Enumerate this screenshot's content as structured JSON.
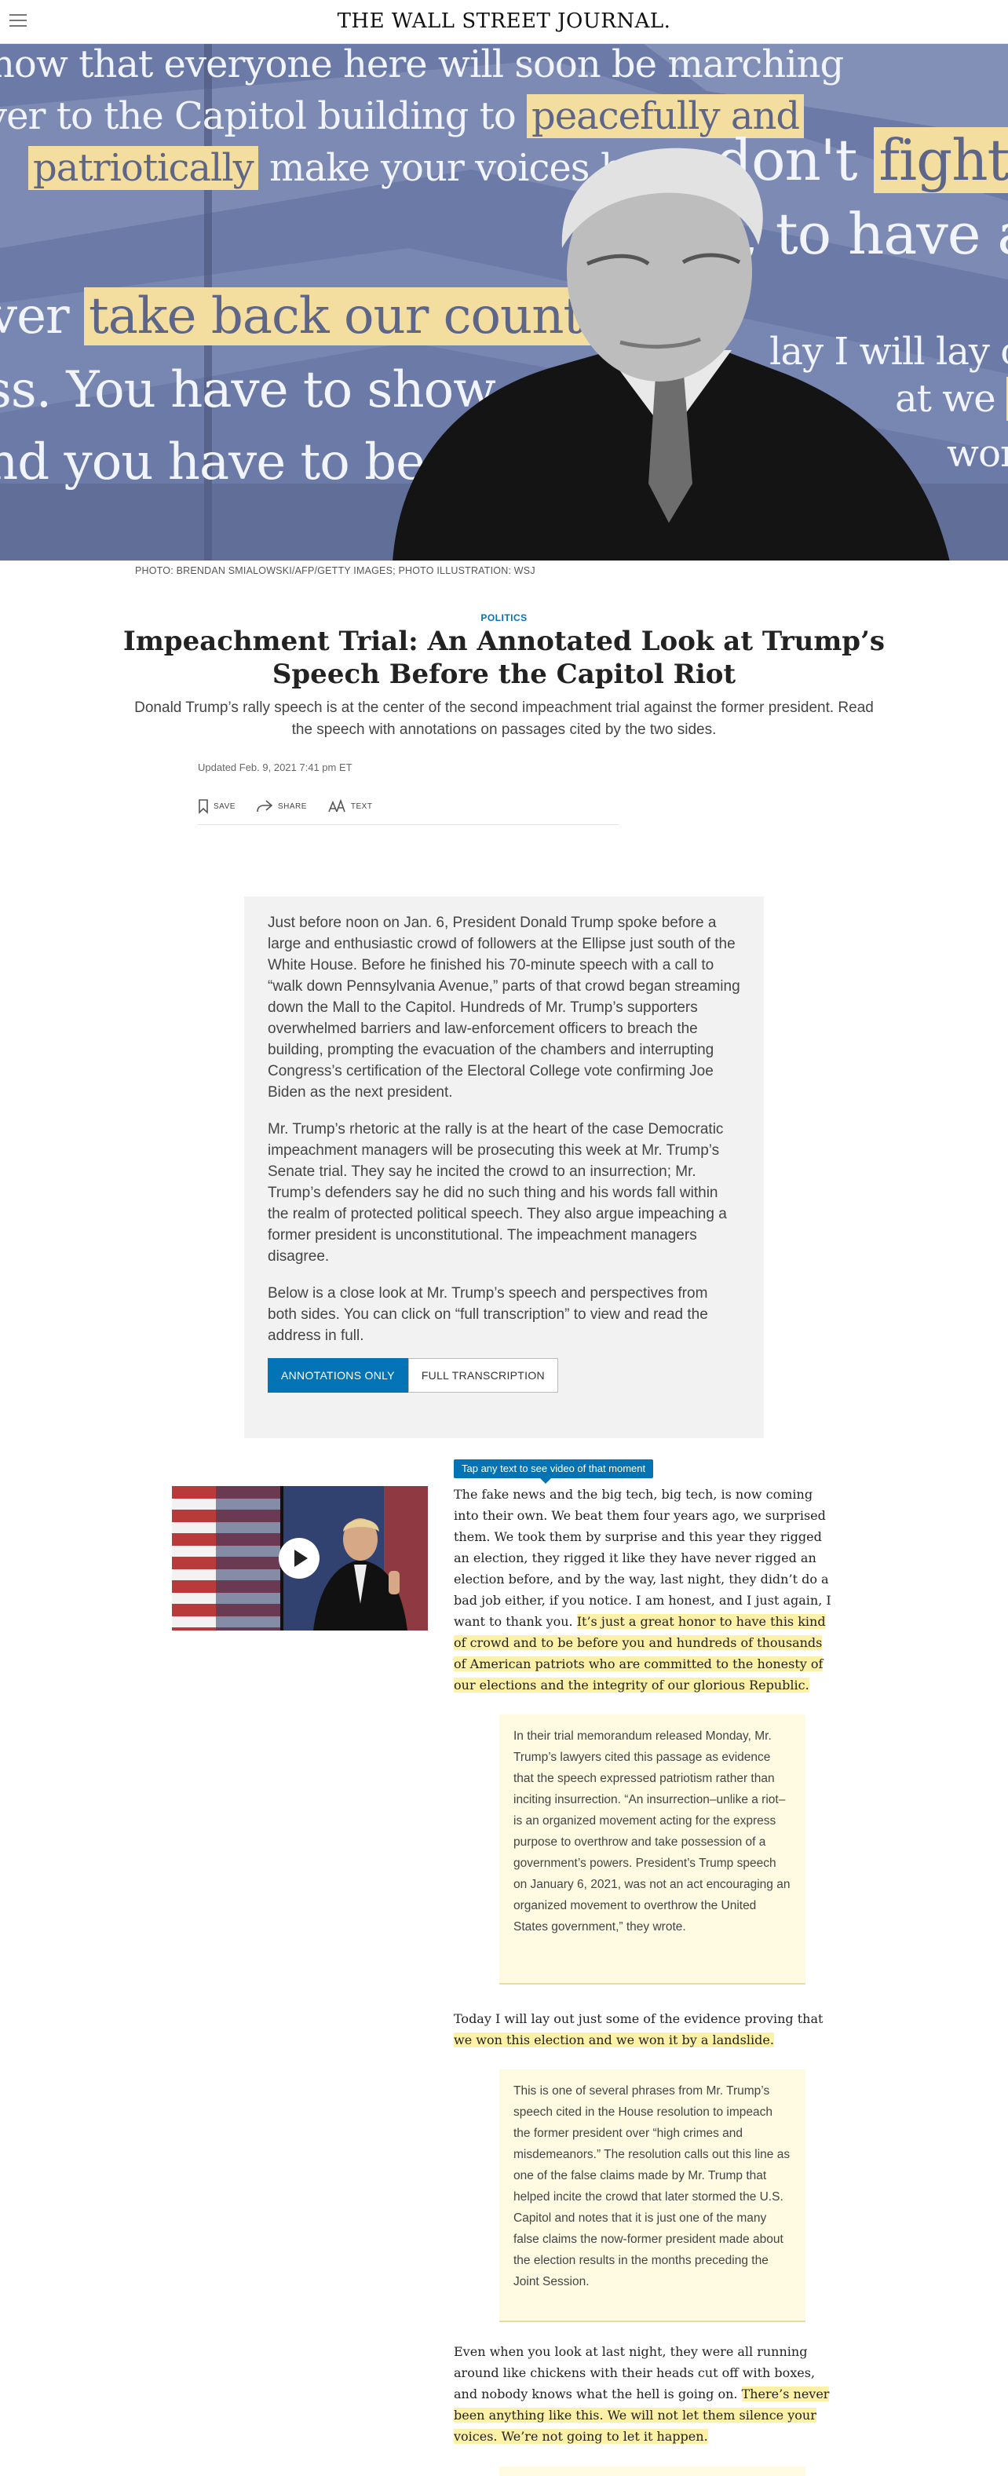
{
  "header": {
    "masthead": "THE WALL STREET JOURNAL.",
    "menu_icon": "hamburger-menu-icon"
  },
  "hero": {
    "lines": [
      {
        "before": "now that everyone here will soon be marching",
        "mark": "",
        "after": ""
      },
      {
        "before": "ver to the Capitol building to ",
        "mark": "peacefully and",
        "after": ""
      },
      {
        "before": "",
        "mark": "patriotically",
        "after": " make your voices he"
      },
      {
        "before": "don't ",
        "mark": "fight l",
        "after": ""
      },
      {
        "before": ", to have a c",
        "mark": "",
        "after": ""
      },
      {
        "before": "ver ",
        "mark": "take back our country",
        "after": " w"
      },
      {
        "before": "lay I will lay out",
        "mark": "",
        "after": ""
      },
      {
        "before": "ss. You have to show st",
        "mark": "",
        "after": ""
      },
      {
        "before": "at we ",
        "mark": "v",
        "after": ""
      },
      {
        "before": "nd you have to be str",
        "mark": "",
        "after": ""
      },
      {
        "before": "won",
        "mark": "",
        "after": ""
      }
    ],
    "photo_credit": "PHOTO: BRENDAN SMIALOWSKI/AFP/GETTY IMAGES; PHOTO ILLUSTRATION: WSJ"
  },
  "article": {
    "section": "POLITICS",
    "headline": "Impeachment Trial: An Annotated Look at Trump’s Speech Before the Capitol Riot",
    "dek": "Donald Trump’s rally speech is at the center of the second impeachment trial against the former president. Read the speech with annotations on passages cited by the two sides.",
    "updated": "Updated Feb. 9, 2021 7:41 pm ET",
    "tools": {
      "save": "SAVE",
      "share": "SHARE",
      "text": "TEXT"
    }
  },
  "intro": {
    "paragraphs": [
      "Just before noon on Jan. 6, President Donald Trump spoke before a large and enthusiastic crowd of followers at the Ellipse just south of the White House. Before he finished his 70-minute speech with a call to “walk down Pennsylvania Avenue,” parts of that crowd began streaming down the Mall to the Capitol. Hundreds of Mr. Trump’s supporters overwhelmed barriers and law-enforcement officers to breach the building, prompting the evacuation of the chambers and interrupting Congress’s certification of the Electoral College vote confirming Joe Biden as the next president.",
      "Mr. Trump’s rhetoric at the rally is at the heart of the case Democratic impeachment managers will be prosecuting this week at Mr. Trump’s Senate trial. They say he incited the crowd to an insurrection; Mr. Trump’s defenders say he did no such thing and his words fall within the realm of protected political speech. They also argue impeaching a former president is unconstitutional. The impeachment managers disagree.",
      "Below is a close look at Mr. Trump’s speech and perspectives from both sides. You can click on “full transcription” to view and read the address in full."
    ],
    "toggle": {
      "annotations": "ANNOTATIONS ONLY",
      "full": "FULL TRANSCRIPTION"
    }
  },
  "transcript": {
    "tip": "Tap any text to see video of that moment",
    "p1_plain": "The fake news and the big tech, big tech, is now coming into their own. We beat them four years ago, we surprised them. We took them by surprise and this year they rigged an election, they rigged it like they have never rigged an election before, and by the way, last night, they didn’t do a bad job either, if you notice. I am honest, and I just again, I want to thank you. ",
    "p1_mark": "It’s just a great honor to have this kind of crowd and to be before you and hundreds of thousands of American patriots who are committed to the honesty of our elections and the integrity of our glorious Republic.",
    "note1": "In their trial memorandum released Monday, Mr. Trump’s lawyers cited this passage as evidence that the speech expressed patriotism rather than inciting insurrection. “An insurrection–unlike a riot–is an organized movement acting for the express purpose to overthrow and take possession of a government’s powers. President’s Trump speech on January 6, 2021, was not an act encouraging an organized movement to overthrow the United States government,” they wrote.",
    "p2_plain": "Today I will lay out just some of the evidence proving that ",
    "p2_mark": "we won this election and we won it by a landslide.",
    "note2": "This is one of several phrases from Mr. Trump’s speech cited in the House resolution to impeach the former president over “high crimes and misdemeanors.” The resolution calls out this line as one of the false claims made by Mr. Trump that helped incite the crowd that later stormed the U.S. Capitol and notes that it is just one of the many false claims the now-former president made about the election results in the months preceding the Joint Session.",
    "p3_plain": "Even when you look at last night, they were all running around like chickens with their heads cut off with boxes, and nobody knows what the hell is going on. ",
    "p3_mark": "There’s never been anything like this. We will not let them silence your voices. We’re not going to let it happen."
  },
  "colors": {
    "accent": "#0274b6",
    "highlight": "#fdf1a8",
    "hero_highlight": "#f3dea0",
    "note_bg": "#fefbe2"
  }
}
